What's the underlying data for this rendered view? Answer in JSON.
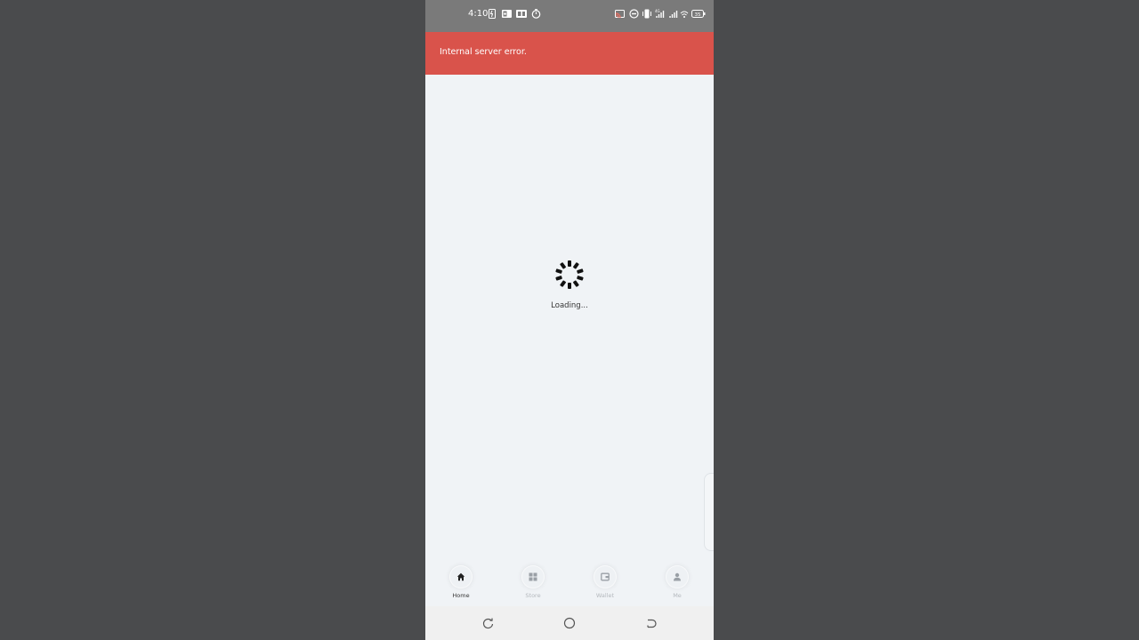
{
  "status_bar": {
    "time": "4:10",
    "battery": "35",
    "icons": [
      "battery-saver-icon",
      "outlook-icon",
      "office-icon",
      "timer-icon",
      "cast-icon",
      "do-not-disturb-icon",
      "vibrate-icon",
      "signal-4g-icon",
      "signal-icon",
      "wifi-icon",
      "battery-icon"
    ]
  },
  "error_banner": {
    "message": "Internal server error.",
    "color": "#d9534b"
  },
  "loader": {
    "text": "Loading...",
    "icon": "spinner-icon"
  },
  "bottom_nav": {
    "items": [
      {
        "label": "Home",
        "icon": "home-icon",
        "active": true
      },
      {
        "label": "Store",
        "icon": "grid-icon",
        "active": false
      },
      {
        "label": "Wallet",
        "icon": "wallet-icon",
        "active": false
      },
      {
        "label": "Me",
        "icon": "person-icon",
        "active": false
      }
    ]
  },
  "system_nav": {
    "buttons": [
      "recents-icon",
      "home-circle-icon",
      "back-icon"
    ]
  },
  "colors": {
    "background": "#4a4b4d",
    "screen": "#f0f3f6",
    "status_bar": "#7a7a7a"
  }
}
